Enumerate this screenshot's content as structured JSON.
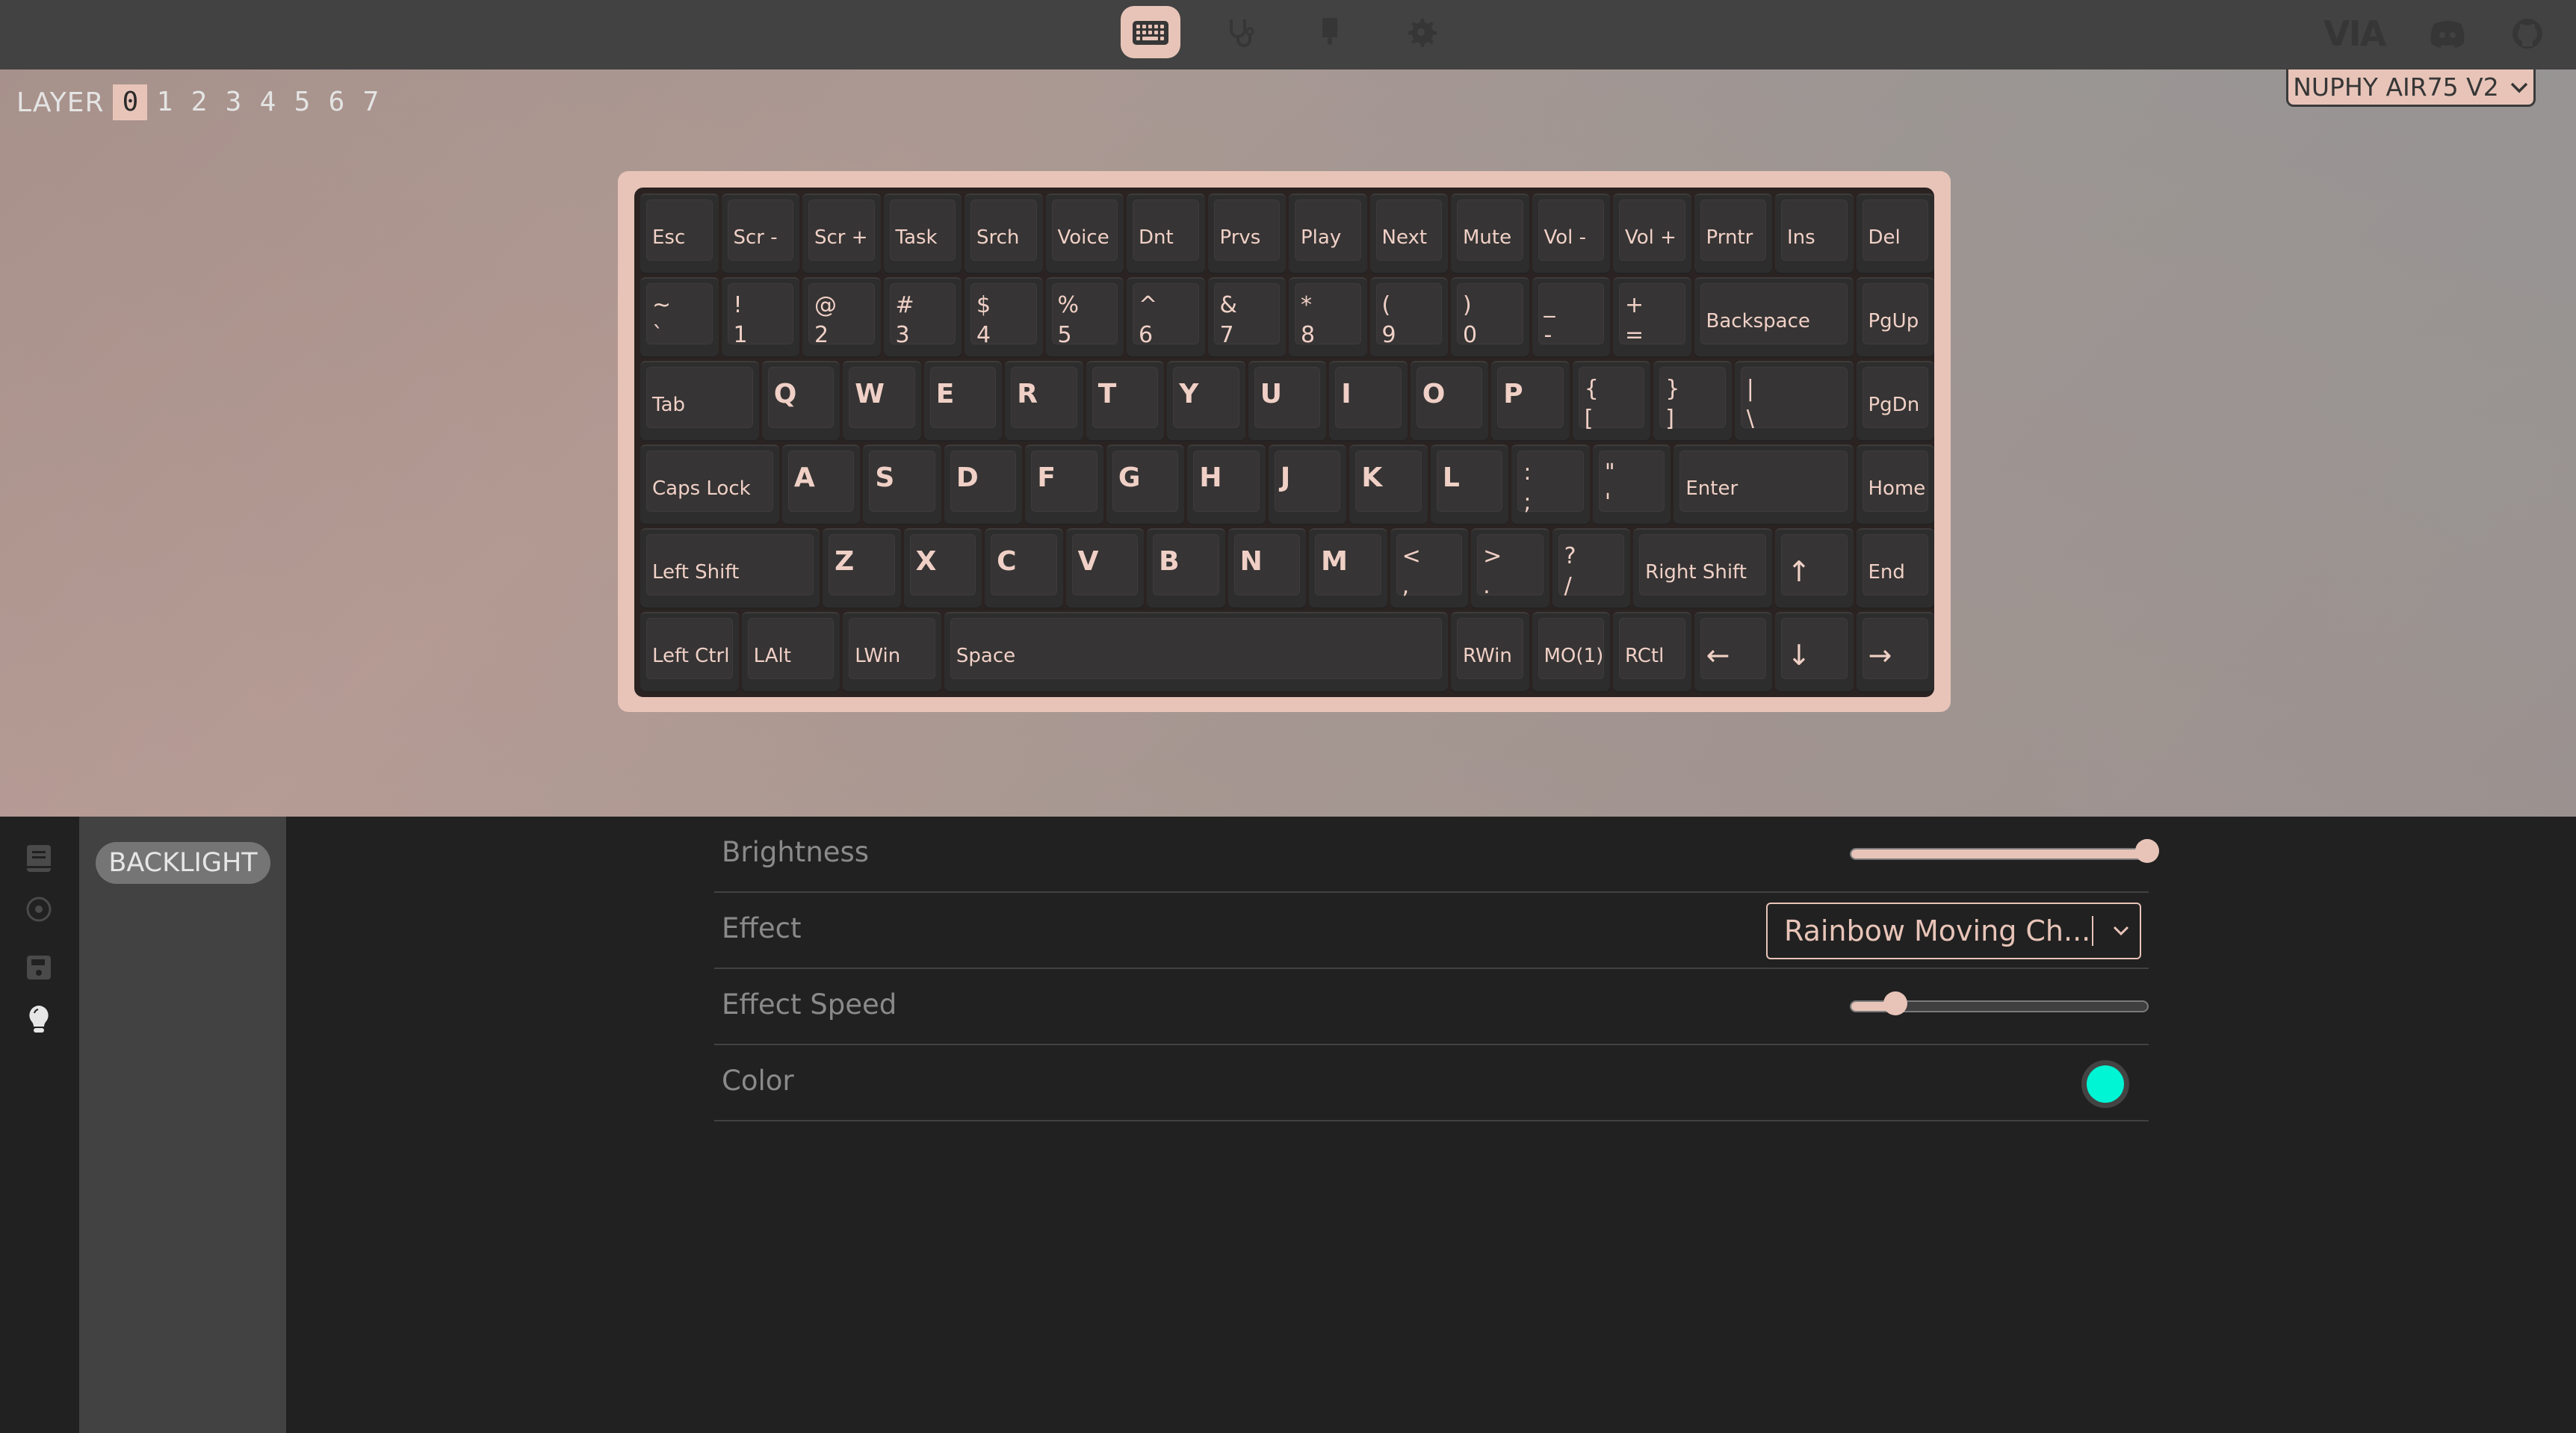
{
  "topbar": {
    "nav": [
      {
        "name": "configure",
        "icon": "keyboard-icon",
        "active": true
      },
      {
        "name": "test",
        "icon": "stethoscope-icon",
        "active": false
      },
      {
        "name": "design",
        "icon": "paintbrush-icon",
        "active": false
      },
      {
        "name": "settings",
        "icon": "gear-icon",
        "active": false
      }
    ],
    "external": {
      "via_logo": "VIA",
      "discord": "discord-icon",
      "github": "github-icon"
    }
  },
  "layers": {
    "label": "LAYER",
    "items": [
      "0",
      "1",
      "2",
      "3",
      "4",
      "5",
      "6",
      "7"
    ],
    "active": "0"
  },
  "keyboard_selector": {
    "value": "NUPHY AIR75 V2"
  },
  "keyboard": {
    "rows": [
      [
        {
          "t": "Esc"
        },
        {
          "t": "Scr -"
        },
        {
          "t": "Scr +"
        },
        {
          "t": "Task"
        },
        {
          "t": "Srch"
        },
        {
          "t": "Voice"
        },
        {
          "t": "Dnt"
        },
        {
          "t": "Prvs"
        },
        {
          "t": "Play"
        },
        {
          "t": "Next"
        },
        {
          "t": "Mute"
        },
        {
          "t": "Vol -"
        },
        {
          "t": "Vol +"
        },
        {
          "t": "Prntr"
        },
        {
          "t": "Ins"
        },
        {
          "t": "Del"
        }
      ],
      [
        {
          "top": "~",
          "bot": "`"
        },
        {
          "top": "!",
          "bot": "1"
        },
        {
          "top": "@",
          "bot": "2"
        },
        {
          "top": "#",
          "bot": "3"
        },
        {
          "top": "$",
          "bot": "4"
        },
        {
          "top": "%",
          "bot": "5"
        },
        {
          "top": "^",
          "bot": "6"
        },
        {
          "top": "&",
          "bot": "7"
        },
        {
          "top": "*",
          "bot": "8"
        },
        {
          "top": "(",
          "bot": "9"
        },
        {
          "top": ")",
          "bot": "0"
        },
        {
          "top": "_",
          "bot": "-"
        },
        {
          "top": "+",
          "bot": "="
        },
        {
          "t": "Backspace"
        },
        {
          "t": "PgUp"
        }
      ],
      [
        {
          "t": "Tab"
        },
        {
          "l": "Q"
        },
        {
          "l": "W"
        },
        {
          "l": "E"
        },
        {
          "l": "R"
        },
        {
          "l": "T"
        },
        {
          "l": "Y"
        },
        {
          "l": "U"
        },
        {
          "l": "I"
        },
        {
          "l": "O"
        },
        {
          "l": "P"
        },
        {
          "top": "{",
          "bot": "["
        },
        {
          "top": "}",
          "bot": "]"
        },
        {
          "top": "|",
          "bot": "\\"
        },
        {
          "t": "PgDn"
        }
      ],
      [
        {
          "t": "Caps Lock"
        },
        {
          "l": "A"
        },
        {
          "l": "S"
        },
        {
          "l": "D"
        },
        {
          "l": "F"
        },
        {
          "l": "G"
        },
        {
          "l": "H"
        },
        {
          "l": "J"
        },
        {
          "l": "K"
        },
        {
          "l": "L"
        },
        {
          "top": ":",
          "bot": ";"
        },
        {
          "top": "\"",
          "bot": "'"
        },
        {
          "t": "Enter"
        },
        {
          "t": "Home"
        }
      ],
      [
        {
          "t": "Left Shift"
        },
        {
          "l": "Z"
        },
        {
          "l": "X"
        },
        {
          "l": "C"
        },
        {
          "l": "V"
        },
        {
          "l": "B"
        },
        {
          "l": "N"
        },
        {
          "l": "M"
        },
        {
          "top": "<",
          "bot": ","
        },
        {
          "top": ">",
          "bot": "."
        },
        {
          "top": "?",
          "bot": "/"
        },
        {
          "t": "Right Shift"
        },
        {
          "a": "↑"
        },
        {
          "t": "End"
        }
      ],
      [
        {
          "t": "Left Ctrl"
        },
        {
          "t": "LAlt"
        },
        {
          "t": "LWin"
        },
        {
          "t": "Space"
        },
        {
          "t": "RWin"
        },
        {
          "t": "MO(1)"
        },
        {
          "t": "RCtl"
        },
        {
          "a": "←"
        },
        {
          "a": "↓"
        },
        {
          "a": "→"
        }
      ]
    ]
  },
  "sidebar": {
    "icons": [
      "book-icon",
      "target-icon",
      "save-icon",
      "lightbulb-icon"
    ],
    "active_icon": "lightbulb-icon",
    "menu": [
      {
        "label": "BACKLIGHT",
        "active": true
      }
    ]
  },
  "settings": {
    "brightness": {
      "label": "Brightness",
      "value_percent": 100
    },
    "effect": {
      "label": "Effect",
      "value": "Rainbow Moving Ch..."
    },
    "effect_speed": {
      "label": "Effect Speed",
      "value_percent": 15
    },
    "color": {
      "label": "Color",
      "value": "#00f5d4"
    }
  },
  "colors": {
    "accent": "#e8c4b8",
    "topbar": "#424242",
    "panel": "#212121"
  }
}
